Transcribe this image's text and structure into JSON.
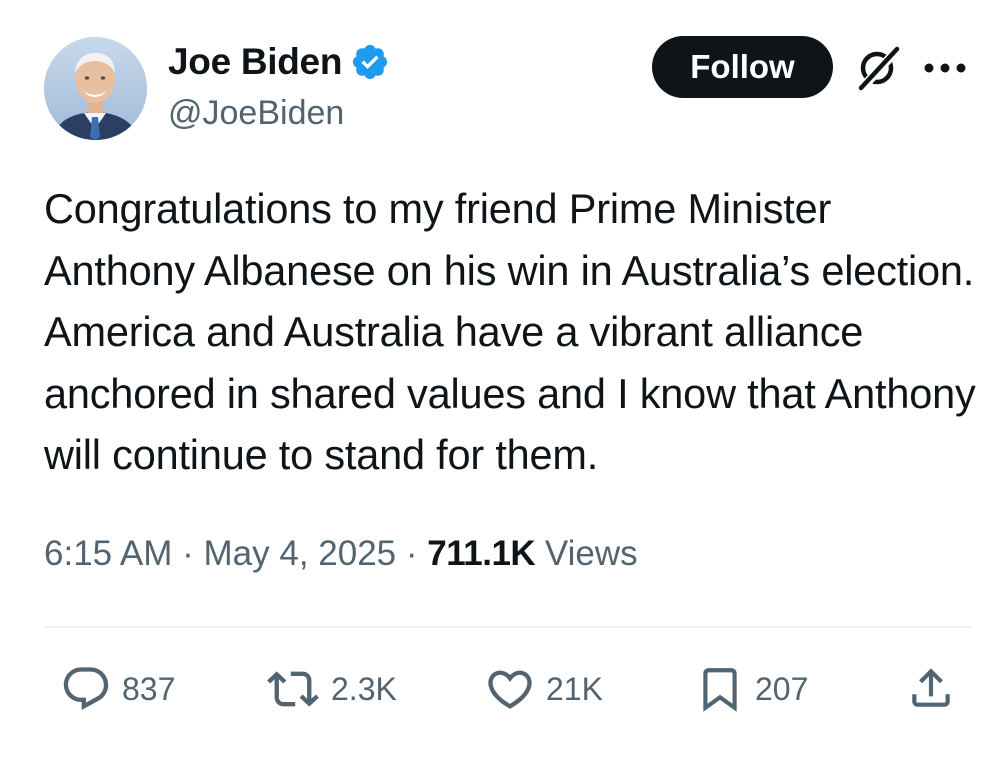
{
  "author": {
    "display_name": "Joe Biden",
    "handle": "@JoeBiden",
    "verified_icon": "verified-badge-icon",
    "avatar": "profile-photo"
  },
  "header": {
    "follow_label": "Follow",
    "grok_icon": "grok-icon",
    "more_icon": "more-options-icon"
  },
  "tweet": {
    "text": "Congratulations to my friend Prime Minister Anthony Albanese on his win in Australia’s election. America and Australia have a vibrant alliance anchored in shared values and I know that Anthony will continue to stand for them."
  },
  "meta": {
    "time": "6:15 AM",
    "separator": " · ",
    "date": "May 4, 2025",
    "views_count": "711.1K",
    "views_label": " Views"
  },
  "actions": {
    "replies": "837",
    "reposts": "2.3K",
    "likes": "21K",
    "bookmarks": "207"
  },
  "colors": {
    "text_primary": "#0f1419",
    "text_secondary": "#536471",
    "verified_blue": "#1d9bf0",
    "divider": "#eff3f4"
  }
}
